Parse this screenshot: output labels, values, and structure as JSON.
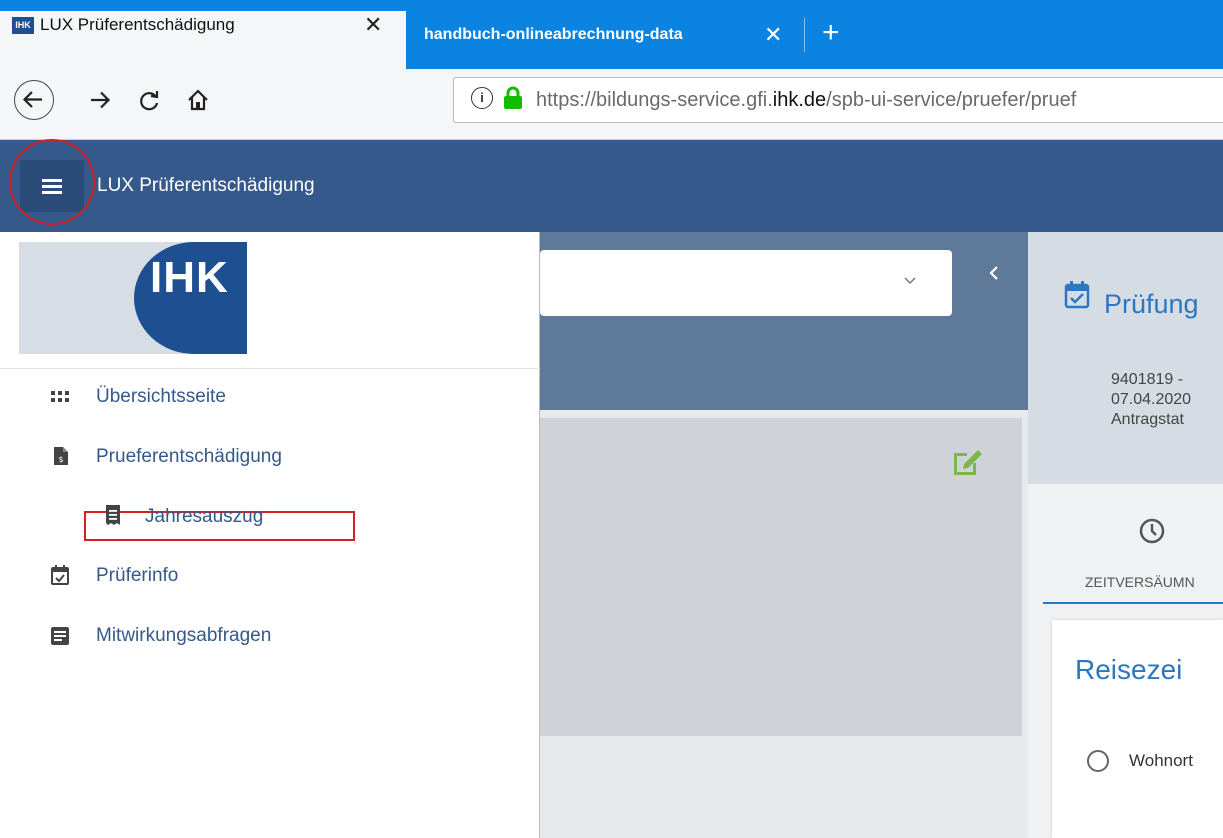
{
  "browser": {
    "tabs": [
      {
        "label": "LUX Prüferentschädigung",
        "favicon": "IHK",
        "active": true
      },
      {
        "label": "handbuch-onlineabrechnung-data",
        "active": false
      }
    ],
    "url": {
      "prefix": "https://bildungs-service.gfi.",
      "domain": "ihk.de",
      "path": "/spb-ui-service/pruefer/pruef"
    }
  },
  "app": {
    "title": "LUX Prüferentschädigung"
  },
  "sidebar": {
    "logo_text": "IHK",
    "items": [
      {
        "label": "Übersichtsseite",
        "icon": "grid-dots-icon"
      },
      {
        "label": "Prueferentschädigung",
        "icon": "file-euro-icon"
      },
      {
        "label": "Jahresauszug",
        "icon": "receipt-icon",
        "sub": true
      },
      {
        "label": "Prüferinfo",
        "icon": "calendar-check-icon"
      },
      {
        "label": "Mitwirkungsabfragen",
        "icon": "form-icon"
      }
    ]
  },
  "main": {
    "right_title": "Prüfung",
    "info_lines": [
      "9401819 -",
      "07.04.2020",
      "Antragstat"
    ],
    "tab_label": "ZEITVERSÄUMN",
    "card_title": "Reisezei",
    "radio_label": "Wohnort"
  },
  "colors": {
    "appbar": "#34598a",
    "highlight": "#d42020",
    "ihk_blue": "#1d4f91",
    "accent": "#2a77c2"
  }
}
